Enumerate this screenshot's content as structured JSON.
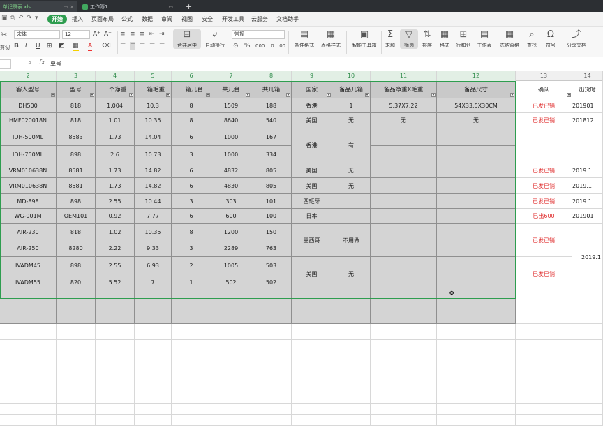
{
  "tabs": [
    {
      "label": "单记录表.xls",
      "active": true
    },
    {
      "label": "工作簿1",
      "active": false
    }
  ],
  "tab_add": "+",
  "menu": [
    "开始",
    "插入",
    "页面布局",
    "公式",
    "数据",
    "审阅",
    "视图",
    "安全",
    "开发工具",
    "云服务",
    "文档助手"
  ],
  "active_menu": "开始",
  "font": {
    "name": "宋体",
    "size": "12"
  },
  "number_format": "常规",
  "ribbon": {
    "cut": "剪切",
    "merge": "合并居中",
    "wrap": "自动换行",
    "cond_format": "条件格式",
    "table_style": "表格样式",
    "smart_tools": "智能工具箱",
    "sum": "求和",
    "filter": "筛选",
    "sort": "排序",
    "format": "格式",
    "rowcol": "行和列",
    "worksheet": "工作表",
    "freeze": "冻结窗格",
    "find": "查找",
    "symbol": "符号",
    "share": "分享文档"
  },
  "formula": {
    "fx": "fx",
    "content": "单号"
  },
  "col_headers": [
    "2",
    "3",
    "4",
    "5",
    "6",
    "7",
    "8",
    "9",
    "10",
    "11",
    "12",
    "13",
    "14"
  ],
  "headers": [
    "客人型号",
    "型号",
    "一个净重",
    "一箱毛重",
    "一箱几台",
    "共几台",
    "共几箱",
    "国家",
    "备品几箱",
    "备品净重X毛重",
    "备品尺寸",
    "确认",
    "出货时"
  ],
  "rows": [
    [
      "DH500",
      "818",
      "1.004",
      "10.3",
      "8",
      "1509",
      "188",
      "香港",
      "1",
      "5.37X7.22",
      "54X33.5X30CM",
      "已发已销",
      "201901"
    ],
    [
      "HMF020018N",
      "818",
      "1.01",
      "10.35",
      "8",
      "8640",
      "540",
      "美国",
      "无",
      "无",
      "无",
      "已发已销",
      "201812"
    ],
    [
      "IDH-500ML",
      "8583",
      "1.73",
      "14.04",
      "6",
      "1000",
      "167",
      "",
      "",
      "",
      "",
      "",
      ""
    ],
    [
      "IDH-750ML",
      "898",
      "2.6",
      "10.73",
      "3",
      "1000",
      "334",
      "",
      "",
      "",
      "",
      "",
      ""
    ],
    [
      "VRM010638N",
      "8581",
      "1.73",
      "14.82",
      "6",
      "4832",
      "805",
      "美国",
      "无",
      "",
      "",
      "已发已销",
      "2019.1"
    ],
    [
      "VRM010638N",
      "8581",
      "1.73",
      "14.82",
      "6",
      "4830",
      "805",
      "美国",
      "无",
      "",
      "",
      "已发已销",
      "2019.1"
    ],
    [
      "MD-898",
      "898",
      "2.55",
      "10.44",
      "3",
      "303",
      "101",
      "西班牙",
      "",
      "",
      "",
      "已发已销",
      "2019.1"
    ],
    [
      "WG-001M",
      "OEM101",
      "0.92",
      "7.77",
      "6",
      "600",
      "100",
      "日本",
      "",
      "",
      "",
      "已出600",
      "201901"
    ],
    [
      "AIR-230",
      "818",
      "1.02",
      "10.35",
      "8",
      "1200",
      "150",
      "",
      "",
      "",
      "",
      "",
      ""
    ],
    [
      "AIR-250",
      "8280",
      "2.22",
      "9.33",
      "3",
      "2289",
      "763",
      "",
      "",
      "",
      "",
      "",
      ""
    ],
    [
      "IVADM45",
      "898",
      "2.55",
      "6.93",
      "2",
      "1005",
      "503",
      "",
      "",
      "",
      "",
      "",
      ""
    ],
    [
      "IVADM55",
      "820",
      "5.52",
      "7",
      "1",
      "502",
      "502",
      "",
      "",
      "",
      "",
      "",
      ""
    ]
  ],
  "merged": {
    "hk": "香港",
    "hk_spare": "有",
    "mexico": "墨西哥",
    "mexico_spare": "不用做",
    "us": "美国",
    "us_spare": "无",
    "confirm_1": "已发已销",
    "confirm_2": "已发已销",
    "date_merged": "2019.1"
  }
}
